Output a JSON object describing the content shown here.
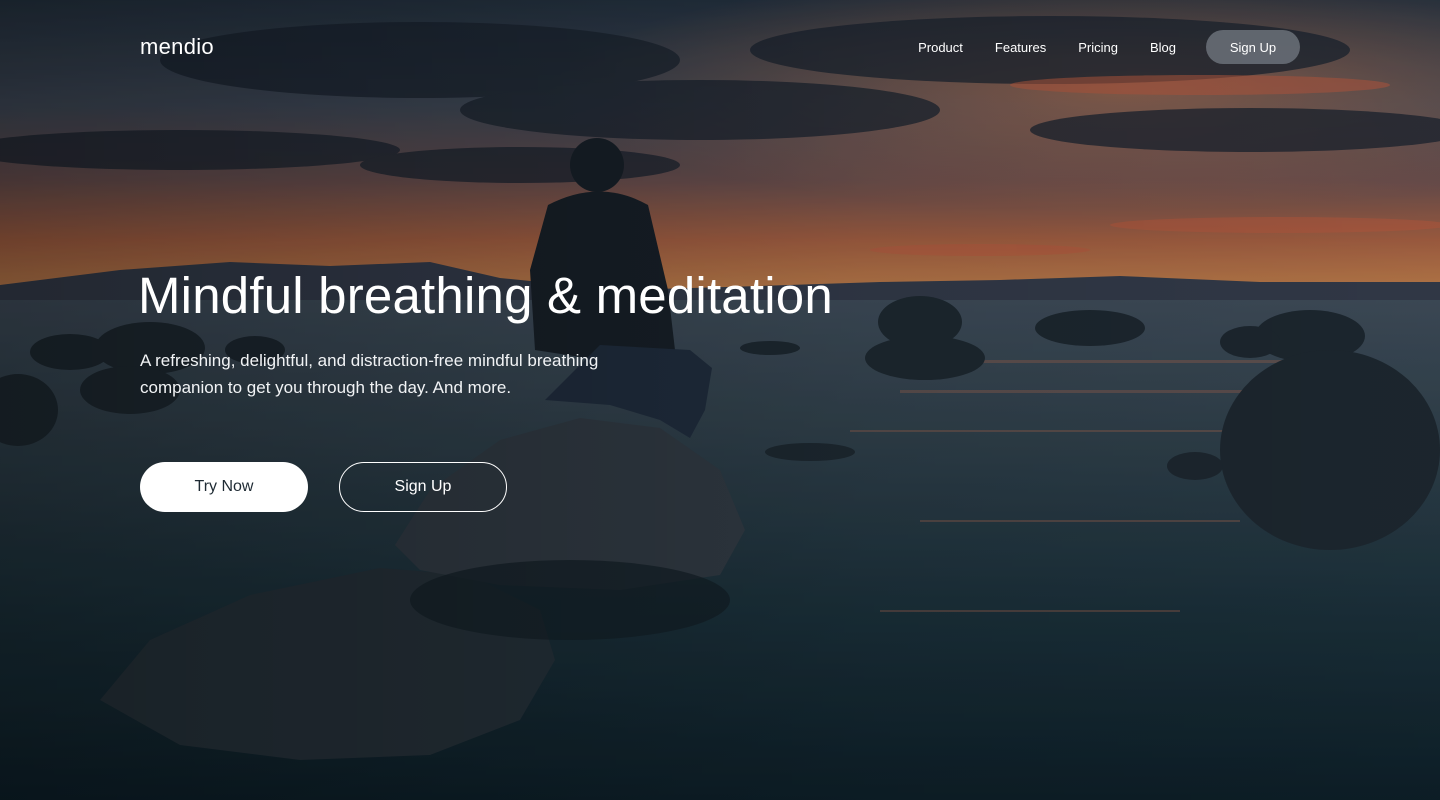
{
  "brand": {
    "name": "mendio"
  },
  "nav": {
    "links": [
      {
        "label": "Product"
      },
      {
        "label": "Features"
      },
      {
        "label": "Pricing"
      },
      {
        "label": "Blog"
      }
    ],
    "signup_label": "Sign Up"
  },
  "hero": {
    "title": "Mindful breathing & meditation",
    "subtitle": "A refreshing, delightful, and distraction-free mindful breathing companion to get you through the day. And more.",
    "primary_cta": "Try Now",
    "secondary_cta": "Sign Up",
    "background": {
      "image_description_icon": "photo-person-on-rock-at-lake-sunset",
      "sky_color": "#3b4e60",
      "sunset_color": "#e0784f",
      "water_color": "#1f3a47"
    }
  },
  "colors": {
    "primary_button_bg": "#ffffff",
    "primary_button_text": "#1e2a33",
    "nav_signup_bg": "#6e747c",
    "text": "#ffffff"
  }
}
